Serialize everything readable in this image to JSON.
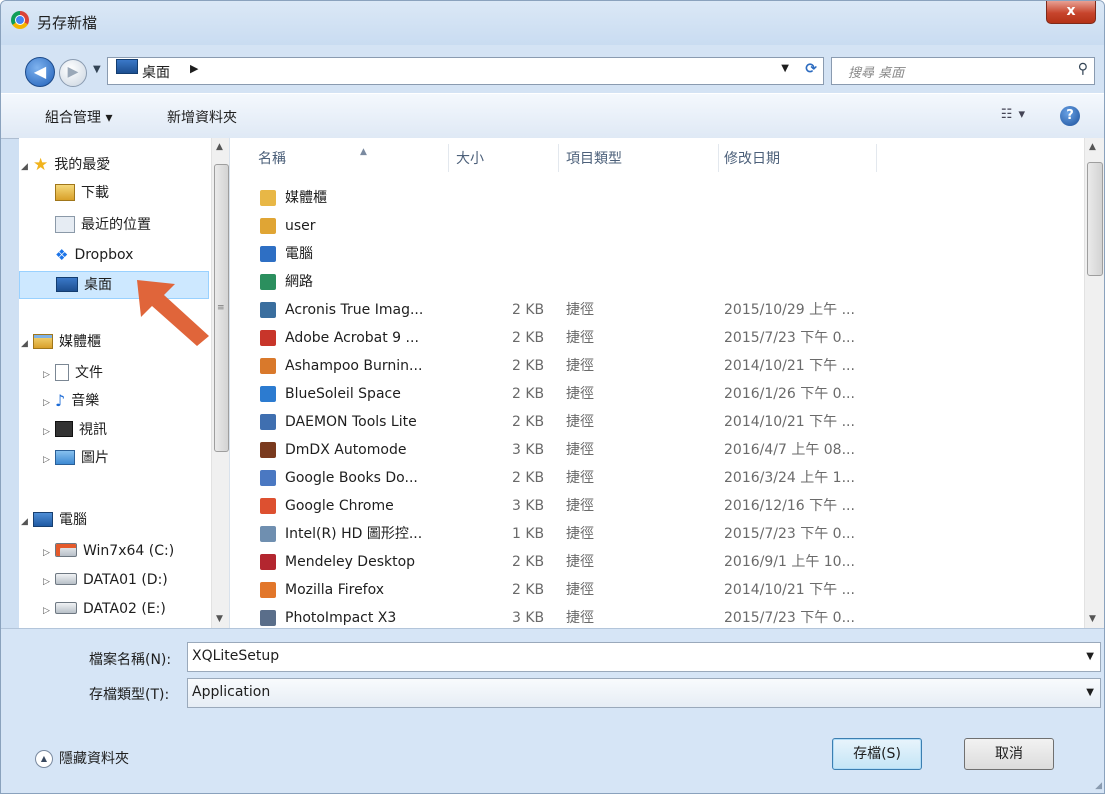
{
  "window": {
    "title": "另存新檔",
    "close_label": "x"
  },
  "address": {
    "path": "桌面",
    "search_placeholder": "搜尋 桌面"
  },
  "toolbar": {
    "organize": "組合管理 ▾",
    "new_folder": "新增資料夾",
    "view": "☷ ▾",
    "help": "?"
  },
  "nav": {
    "favorites": "我的最愛",
    "downloads": "下載",
    "recent": "最近的位置",
    "dropbox": "Dropbox",
    "desktop": "桌面",
    "libraries": "媒體櫃",
    "docs": "文件",
    "music": "音樂",
    "video": "視訊",
    "pictures": "圖片",
    "computer": "電腦",
    "drive_c": "Win7x64 (C:)",
    "drive_d": "DATA01 (D:)",
    "drive_e": "DATA02 (E:)"
  },
  "columns": {
    "name": "名稱",
    "size": "大小",
    "type": "項目類型",
    "date": "修改日期"
  },
  "files": [
    {
      "name": "媒體櫃",
      "size": "",
      "type": "",
      "date": "",
      "icon_color": "#e8b746"
    },
    {
      "name": "user",
      "size": "",
      "type": "",
      "date": "",
      "icon_color": "#e0a534"
    },
    {
      "name": "電腦",
      "size": "",
      "type": "",
      "date": "",
      "icon_color": "#2e6fc4"
    },
    {
      "name": "網路",
      "size": "",
      "type": "",
      "date": "",
      "icon_color": "#2b8f5e"
    },
    {
      "name": "Acronis True Imag...",
      "size": "2 KB",
      "type": "捷徑",
      "date": "2015/10/29 上午 ...",
      "icon_color": "#3a6e9e"
    },
    {
      "name": "Adobe Acrobat 9 ...",
      "size": "2 KB",
      "type": "捷徑",
      "date": "2015/7/23 下午 0...",
      "icon_color": "#c8352a"
    },
    {
      "name": "Ashampoo Burnin...",
      "size": "2 KB",
      "type": "捷徑",
      "date": "2014/10/21 下午 ...",
      "icon_color": "#d9792b"
    },
    {
      "name": "BlueSoleil Space",
      "size": "2 KB",
      "type": "捷徑",
      "date": "2016/1/26 下午 0...",
      "icon_color": "#2c7bd0"
    },
    {
      "name": "DAEMON Tools Lite",
      "size": "2 KB",
      "type": "捷徑",
      "date": "2014/10/21 下午 ...",
      "icon_color": "#3f6fb0"
    },
    {
      "name": "DmDX Automode",
      "size": "3 KB",
      "type": "捷徑",
      "date": "2016/4/7 上午 08...",
      "icon_color": "#7a3a1e"
    },
    {
      "name": "Google Books Do...",
      "size": "2 KB",
      "type": "捷徑",
      "date": "2016/3/24 上午 1...",
      "icon_color": "#4a78c2"
    },
    {
      "name": "Google Chrome",
      "size": "3 KB",
      "type": "捷徑",
      "date": "2016/12/16 下午 ...",
      "icon_color": "#dd5030"
    },
    {
      "name": "Intel(R) HD 圖形控...",
      "size": "1 KB",
      "type": "捷徑",
      "date": "2015/7/23 下午 0...",
      "icon_color": "#6f8fb0"
    },
    {
      "name": "Mendeley Desktop",
      "size": "2 KB",
      "type": "捷徑",
      "date": "2016/9/1 上午 10...",
      "icon_color": "#b3262f"
    },
    {
      "name": "Mozilla Firefox",
      "size": "2 KB",
      "type": "捷徑",
      "date": "2014/10/21 下午 ...",
      "icon_color": "#e2762a"
    },
    {
      "name": "PhotoImpact X3",
      "size": "3 KB",
      "type": "捷徑",
      "date": "2015/7/23 下午 0...",
      "icon_color": "#5a6e8a"
    }
  ],
  "form": {
    "filename_label": "檔案名稱(N):",
    "filename_value": "XQLiteSetup",
    "filetype_label": "存檔類型(T):",
    "filetype_value": "Application",
    "hide_folders": "隱藏資料夾",
    "save": "存檔(S)",
    "cancel": "取消"
  },
  "colors": {
    "accent": "#2d6cc0",
    "selection": "#cde8ff",
    "arrow": "#e0653a"
  }
}
